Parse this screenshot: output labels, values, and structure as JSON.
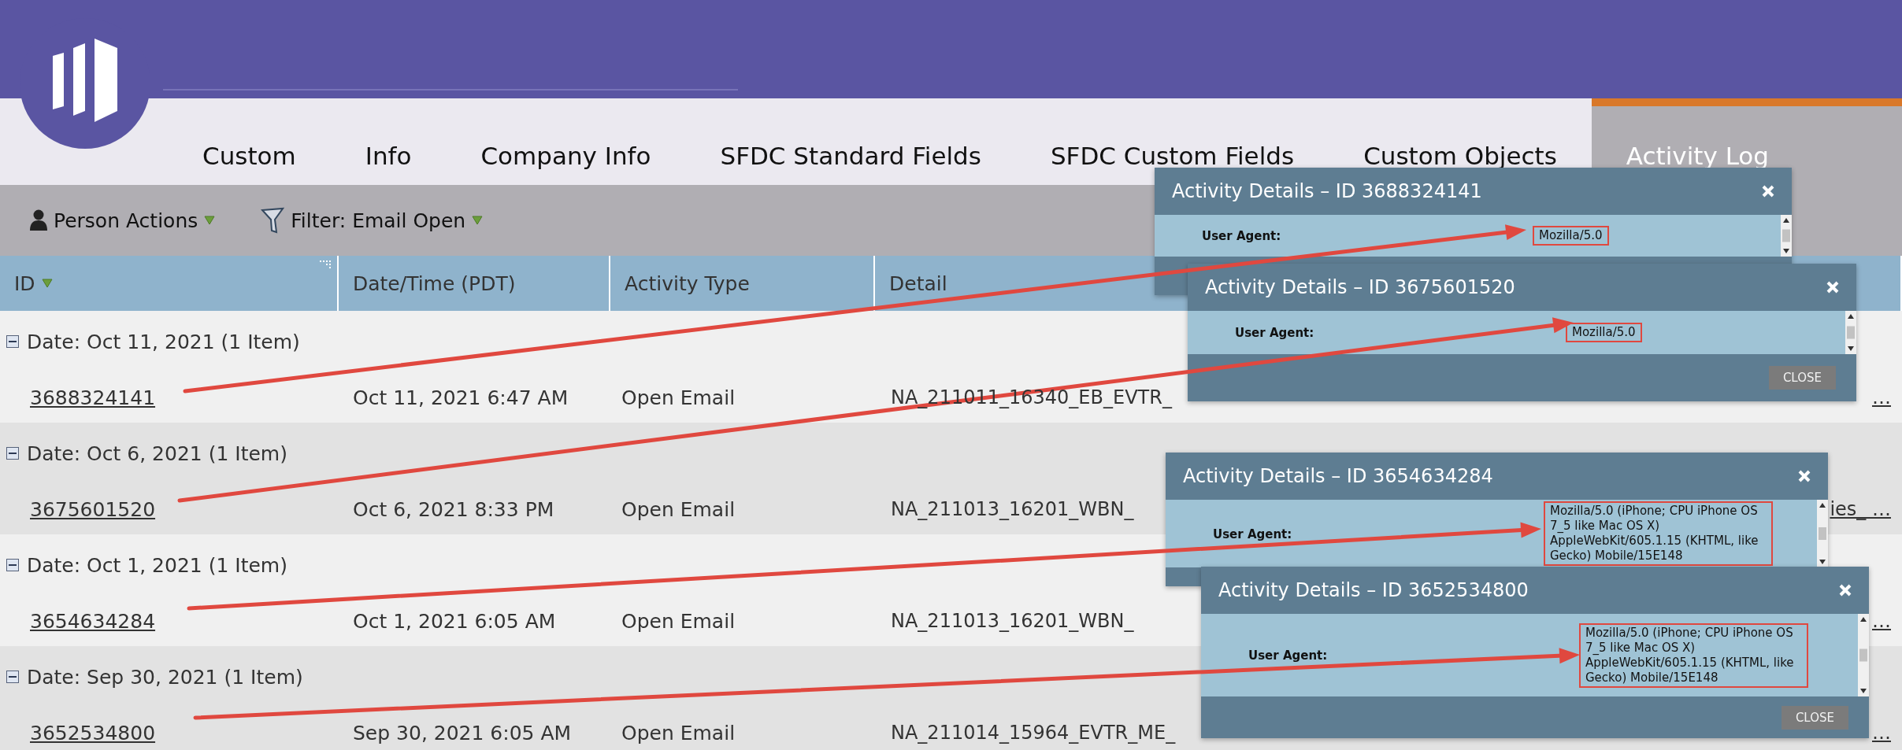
{
  "tabs": [
    {
      "label": "Custom",
      "selected": false
    },
    {
      "label": "Info",
      "selected": false
    },
    {
      "label": "Company Info",
      "selected": false
    },
    {
      "label": "SFDC Standard Fields",
      "selected": false
    },
    {
      "label": "SFDC Custom Fields",
      "selected": false
    },
    {
      "label": "Custom Objects",
      "selected": false
    },
    {
      "label": "Activity Log",
      "selected": true
    }
  ],
  "toolbar": [
    {
      "label": "Person Actions",
      "kind": "person"
    },
    {
      "label": "Filter: Email Open",
      "kind": "filter"
    }
  ],
  "table": {
    "columns": [
      {
        "label": "ID",
        "has_menu": true
      },
      {
        "label": "Date/Time (PDT)",
        "has_menu": false
      },
      {
        "label": "Activity Type",
        "has_menu": false
      },
      {
        "label": "Detail",
        "has_menu": false
      }
    ],
    "groups": [
      {
        "label": "Date: Oct 11, 2021 (1 Item)",
        "expanded": true,
        "rows": [
          {
            "id": "3688324141",
            "datetime": "Oct 11, 2021 6:47 AM",
            "type": "Open Email",
            "detail": "NA_211011_16340_EB_EVTR_",
            "detail_end": "…"
          }
        ]
      },
      {
        "label": "Date: Oct 6, 2021 (1 Item)",
        "expanded": true,
        "rows": [
          {
            "id": "3675601520",
            "datetime": "Oct 6, 2021 8:33 PM",
            "type": "Open Email",
            "detail": "NA_211013_16201_WBN_",
            "detail_end": "ies_ …"
          }
        ]
      },
      {
        "label": "Date: Oct 1, 2021 (1 Item)",
        "expanded": true,
        "rows": [
          {
            "id": "3654634284",
            "datetime": "Oct 1, 2021 6:05 AM",
            "type": "Open Email",
            "detail": "NA_211013_16201_WBN_",
            "detail_end": "…"
          }
        ]
      },
      {
        "label": "Date: Sep 30, 2021 (1 Item)",
        "expanded": true,
        "rows": [
          {
            "id": "3652534800",
            "datetime": "Sep 30, 2021 6:05 AM",
            "type": "Open Email",
            "detail": "NA_211014_15964_EVTR_ME_",
            "detail_end": "…"
          }
        ]
      }
    ]
  },
  "popups": [
    {
      "title": "Activity Details – ID 3688324141",
      "fields": [
        {
          "label": "User Agent:",
          "value": "Mozilla/5.0",
          "highlighted": true
        }
      ]
    },
    {
      "title": "Activity Details – ID 3675601520",
      "fields": [
        {
          "label": "User Agent:",
          "value": "Mozilla/5.0",
          "highlighted": true
        }
      ],
      "close": "CLOSE"
    },
    {
      "title": "Activity Details – ID 3654634284",
      "fields": [
        {
          "label": "User Agent:",
          "value": "Mozilla/5.0 (iPhone; CPU iPhone OS 7_5 like Mac OS X) AppleWebKit/605.1.15 (KHTML, like Gecko) Mobile/15E148",
          "highlighted": true
        }
      ]
    },
    {
      "title": "Activity Details – ID 3652534800",
      "fields": [
        {
          "label": "User Agent:",
          "value": "Mozilla/5.0 (iPhone; CPU iPhone OS 7_5 like Mac OS X) AppleWebKit/605.1.15 (KHTML, like Gecko) Mobile/15E148",
          "highlighted": true
        }
      ],
      "close": "CLOSE"
    }
  ]
}
